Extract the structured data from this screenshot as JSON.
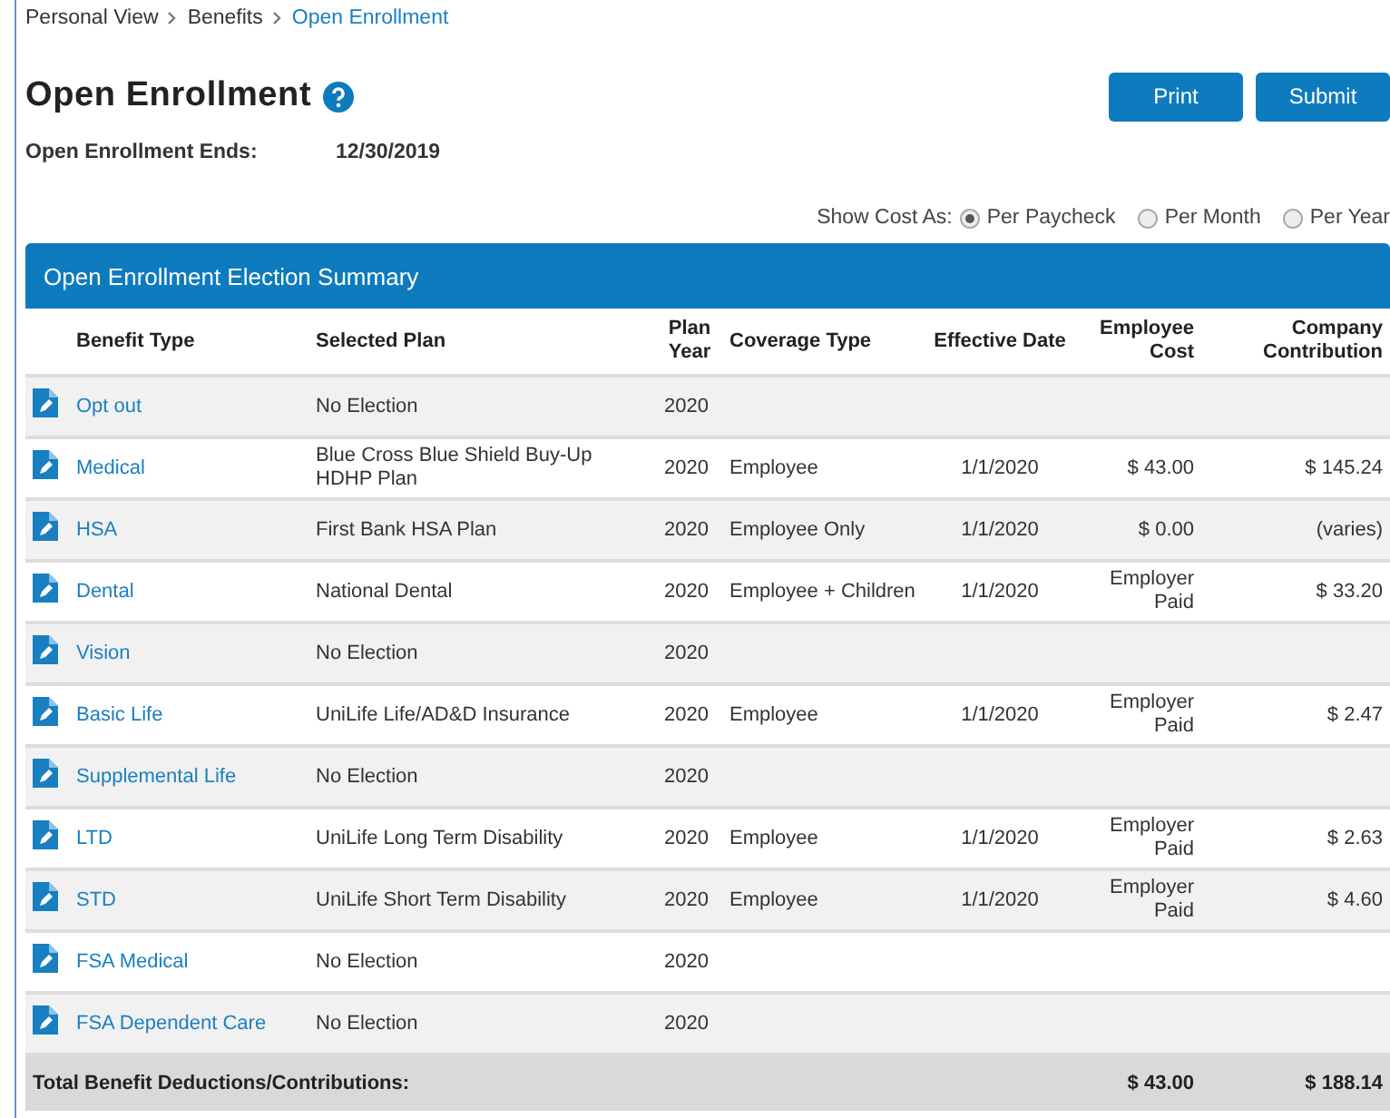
{
  "breadcrumb": [
    {
      "label": "Personal View",
      "current": false
    },
    {
      "label": "Benefits",
      "current": false
    },
    {
      "label": "Open Enrollment",
      "current": true
    }
  ],
  "title": "Open Enrollment",
  "buttons": [
    "Print",
    "Submit"
  ],
  "enrollment_ends": {
    "label": "Open Enrollment Ends:",
    "value": "12/30/2019"
  },
  "show_cost": {
    "label": "Show Cost As:",
    "options": [
      {
        "label": "Per Paycheck",
        "selected": true
      },
      {
        "label": "Per Month",
        "selected": false
      },
      {
        "label": "Per Year",
        "selected": false
      }
    ]
  },
  "summary": {
    "title": "Open Enrollment Election Summary",
    "columns": [
      "Benefit Type",
      "Selected Plan",
      "Plan Year",
      "Coverage Type",
      "Effective Date",
      "Employee Cost",
      "Company Contribution"
    ],
    "rows": [
      {
        "benefit_type": "Opt out",
        "selected_plan": "No Election",
        "plan_year": "2020",
        "coverage_type": "",
        "effective_date": "",
        "employee_cost": "",
        "company_contribution": ""
      },
      {
        "benefit_type": "Medical",
        "selected_plan": "Blue Cross Blue Shield Buy-Up HDHP Plan",
        "plan_year": "2020",
        "coverage_type": "Employee",
        "effective_date": "1/1/2020",
        "employee_cost": "$ 43.00",
        "company_contribution": "$ 145.24"
      },
      {
        "benefit_type": "HSA",
        "selected_plan": "First Bank HSA Plan",
        "plan_year": "2020",
        "coverage_type": "Employee Only",
        "effective_date": "1/1/2020",
        "employee_cost": "$ 0.00",
        "company_contribution": "(varies)"
      },
      {
        "benefit_type": "Dental",
        "selected_plan": "National Dental",
        "plan_year": "2020",
        "coverage_type": "Employee + Children",
        "effective_date": "1/1/2020",
        "employee_cost": "Employer Paid",
        "company_contribution": "$ 33.20"
      },
      {
        "benefit_type": "Vision",
        "selected_plan": "No Election",
        "plan_year": "2020",
        "coverage_type": "",
        "effective_date": "",
        "employee_cost": "",
        "company_contribution": ""
      },
      {
        "benefit_type": "Basic Life",
        "selected_plan": "UniLife Life/AD&D Insurance",
        "plan_year": "2020",
        "coverage_type": "Employee",
        "effective_date": "1/1/2020",
        "employee_cost": "Employer Paid",
        "company_contribution": "$ 2.47"
      },
      {
        "benefit_type": "Supplemental Life",
        "selected_plan": "No Election",
        "plan_year": "2020",
        "coverage_type": "",
        "effective_date": "",
        "employee_cost": "",
        "company_contribution": ""
      },
      {
        "benefit_type": "LTD",
        "selected_plan": "UniLife Long Term Disability",
        "plan_year": "2020",
        "coverage_type": "Employee",
        "effective_date": "1/1/2020",
        "employee_cost": "Employer Paid",
        "company_contribution": "$ 2.63"
      },
      {
        "benefit_type": "STD",
        "selected_plan": "UniLife Short Term Disability",
        "plan_year": "2020",
        "coverage_type": "Employee",
        "effective_date": "1/1/2020",
        "employee_cost": "Employer Paid",
        "company_contribution": "$ 4.60"
      },
      {
        "benefit_type": "FSA Medical",
        "selected_plan": "No Election",
        "plan_year": "2020",
        "coverage_type": "",
        "effective_date": "",
        "employee_cost": "",
        "company_contribution": ""
      },
      {
        "benefit_type": "FSA Dependent Care",
        "selected_plan": "No Election",
        "plan_year": "2020",
        "coverage_type": "",
        "effective_date": "",
        "employee_cost": "",
        "company_contribution": ""
      }
    ],
    "total": {
      "label": "Total Benefit Deductions/Contributions:",
      "employee_cost": "$ 43.00",
      "company_contribution": "$ 188.14"
    }
  }
}
